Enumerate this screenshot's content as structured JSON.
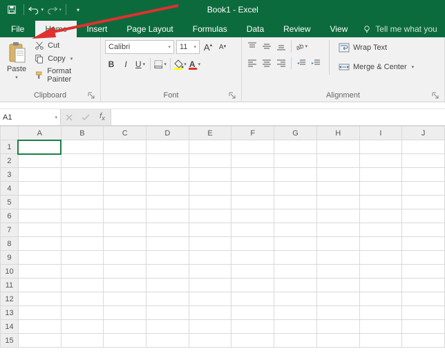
{
  "app": {
    "title": "Book1 - Excel"
  },
  "qat": {
    "save_tip": "Save",
    "undo_tip": "Undo",
    "redo_tip": "Redo",
    "custom_tip": "Customize"
  },
  "tabs": {
    "file": "File",
    "home": "Home",
    "insert": "Insert",
    "pagelayout": "Page Layout",
    "formulas": "Formulas",
    "data": "Data",
    "review": "Review",
    "view": "View",
    "tellme": "Tell me what you"
  },
  "ribbon": {
    "clipboard": {
      "label": "Clipboard",
      "paste": "Paste",
      "cut": "Cut",
      "copy": "Copy",
      "painter": "Format Painter"
    },
    "font": {
      "label": "Font",
      "name": "Calibri",
      "size": "11",
      "increase": "A",
      "decrease": "A",
      "bold": "B",
      "italic": "I",
      "underline": "U"
    },
    "alignment": {
      "label": "Alignment",
      "wrap": "Wrap Text",
      "merge": "Merge & Center"
    }
  },
  "formula_bar": {
    "name_box": "A1",
    "formula": ""
  },
  "grid": {
    "columns": [
      "A",
      "B",
      "C",
      "D",
      "E",
      "F",
      "G",
      "H",
      "I",
      "J"
    ],
    "rows": [
      "1",
      "2",
      "3",
      "4",
      "5",
      "6",
      "7",
      "8",
      "9",
      "10",
      "11",
      "12",
      "13",
      "14",
      "15"
    ],
    "active": "A1"
  }
}
